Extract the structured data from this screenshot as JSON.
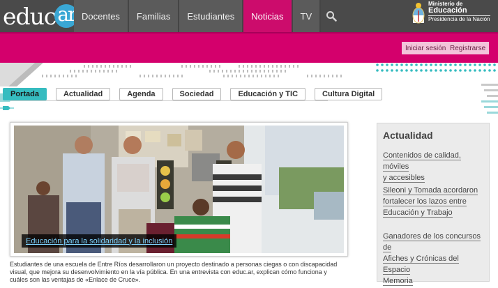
{
  "logo": {
    "text_main": "educ",
    "text_circle": "ar"
  },
  "nav": {
    "items": [
      "Docentes",
      "Familias",
      "Estudiantes",
      "Noticias",
      "TV"
    ],
    "active": "Noticias"
  },
  "ministry": {
    "line1": "Ministerio de",
    "line2": "Educación",
    "line3": "Presidencia de la Nación"
  },
  "auth": {
    "login": "Iniciar sesión",
    "register": "Registrarse"
  },
  "tabs": {
    "items": [
      "Portada",
      "Actualidad",
      "Agenda",
      "Sociedad",
      "Educación y TIC",
      "Cultura Digital"
    ],
    "active": "Portada"
  },
  "feature": {
    "caption": "Educación para la solidaridad y la inclusión",
    "summary": "Estudiantes de una escuela de Entre Ríos desarrollaron un proyecto destinado a personas ciegas o con discapacidad visual, que mejora su desenvolvimiento en la vía pública. En una entrevista con educ.ar, explican cómo funciona y cuáles son las ventajas de «Enlace de Cruce»."
  },
  "sidebar": {
    "title": "Actualidad",
    "items": [
      {
        "lines": [
          "Contenidos de calidad, móviles",
          "y accesibles"
        ]
      },
      {
        "lines": [
          "Sileoni y Tomada acordaron",
          "fortalecer los lazos entre",
          "Educación y Trabajo"
        ]
      },
      {
        "lines": [
          "Ganadores de los concursos de",
          "Afiches y Crónicas del Espacio",
          "Memoria"
        ]
      }
    ]
  },
  "colors": {
    "topbar": "#4a4a4a",
    "magenta": "#d4006c",
    "accent": "#36bcc0",
    "link": "#7fd4ff"
  },
  "icons": {
    "search": "search-icon",
    "shield": "argentina-shield-icon"
  }
}
